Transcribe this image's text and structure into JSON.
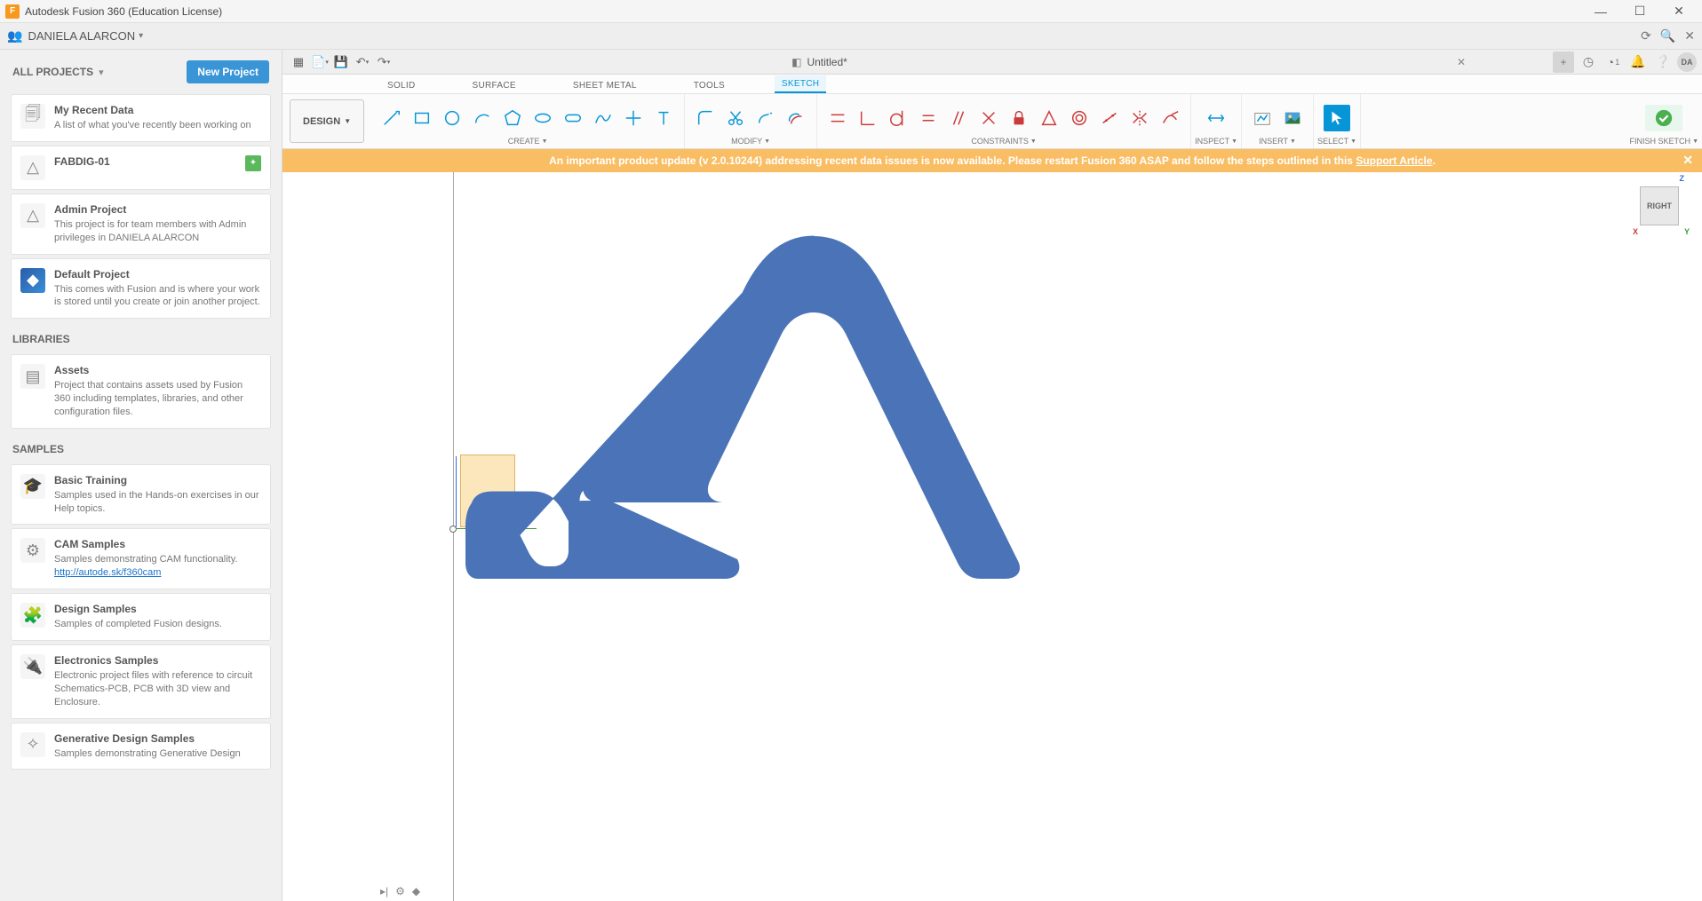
{
  "app": {
    "title": "Autodesk Fusion 360 (Education License)"
  },
  "user": {
    "name": "DANIELA ALARCON",
    "avatar_initials": "DA"
  },
  "sidebar": {
    "all_projects_label": "ALL PROJECTS",
    "new_project_label": "New Project",
    "libraries_label": "LIBRARIES",
    "samples_label": "SAMPLES",
    "items": [
      {
        "title": "My Recent Data",
        "desc": "A list of what you've recently been working on"
      },
      {
        "title": "FABDIG-01",
        "desc": ""
      },
      {
        "title": "Admin Project",
        "desc": "This project is for team members with Admin privileges in DANIELA ALARCON"
      },
      {
        "title": "Default Project",
        "desc": "This comes with Fusion and is where your work is stored until you create or join another project."
      }
    ],
    "libraries": [
      {
        "title": "Assets",
        "desc": "Project that contains assets used by Fusion 360 including templates, libraries, and other configuration files."
      }
    ],
    "samples": [
      {
        "title": "Basic Training",
        "desc": "Samples used in the Hands-on exercises in our Help topics."
      },
      {
        "title": "CAM Samples",
        "desc": "Samples demonstrating CAM functionality.",
        "link_text": "http://autode.sk/f360cam"
      },
      {
        "title": "Design Samples",
        "desc": "Samples of completed Fusion designs."
      },
      {
        "title": "Electronics Samples",
        "desc": "Electronic project files with reference to circuit Schematics-PCB, PCB with 3D view and Enclosure."
      },
      {
        "title": "Generative Design Samples",
        "desc": "Samples demonstrating Generative Design"
      }
    ]
  },
  "document": {
    "name": "Untitled*"
  },
  "topbar": {
    "job_count": "1"
  },
  "ribbon": {
    "design_label": "DESIGN",
    "tabs": [
      "SOLID",
      "SURFACE",
      "SHEET METAL",
      "TOOLS",
      "SKETCH"
    ],
    "active_tab": "SKETCH",
    "groups": {
      "create": "CREATE",
      "modify": "MODIFY",
      "constraints": "CONSTRAINTS",
      "inspect": "INSPECT",
      "insert": "INSERT",
      "select": "SELECT",
      "finish": "FINISH SKETCH"
    }
  },
  "banner": {
    "text_prefix": "An important product update (v 2.0.10244) addressing recent data issues is now available. Please restart Fusion 360 ASAP and follow the steps outlined in this ",
    "link_text": "Support Article",
    "text_suffix": "."
  },
  "viewcube": {
    "face": "RIGHT"
  }
}
